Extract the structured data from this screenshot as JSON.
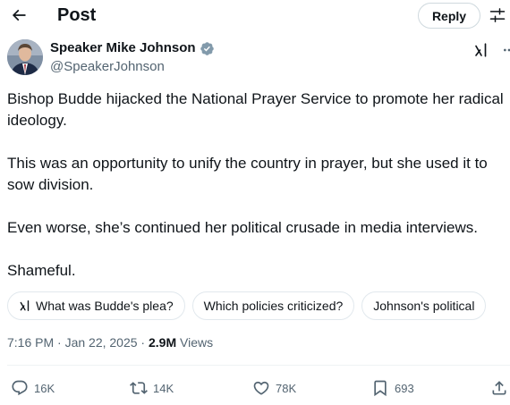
{
  "header": {
    "title": "Post",
    "reply_label": "Reply"
  },
  "author": {
    "name": "Speaker Mike Johnson",
    "handle": "@SpeakerJohnson",
    "verified_color": "#829aab"
  },
  "tweet": {
    "paragraphs": [
      "Bishop Budde hijacked the National Prayer Service to promote her radical ideology.",
      "This was an opportunity to unify the country in prayer, but she used it to sow division.",
      "Even worse, she’s continued her political crusade in media interviews.",
      "Shameful."
    ]
  },
  "suggestions": [
    "What was Budde's plea?",
    "Which policies criticized?",
    "Johnson's political"
  ],
  "meta": {
    "timestamp": "7:16 PM · Jan 22, 2025",
    "separator": " · ",
    "views_count": "2.9M",
    "views_label": "Views"
  },
  "actions": {
    "replies": "16K",
    "reposts": "14K",
    "likes": "78K",
    "bookmarks": "693"
  },
  "icons": {
    "back": "arrow-left-icon",
    "filter": "sliders-icon",
    "verified": "verified-badge-icon",
    "grok": "grok-icon",
    "more": "more-dots-icon",
    "reply": "comment-bubble-icon",
    "repost": "repost-icon",
    "like": "heart-icon",
    "bookmark": "bookmark-icon",
    "share": "share-icon"
  },
  "colors": {
    "text": "#0f1419",
    "secondary": "#536471",
    "border": "#cfd9de"
  }
}
